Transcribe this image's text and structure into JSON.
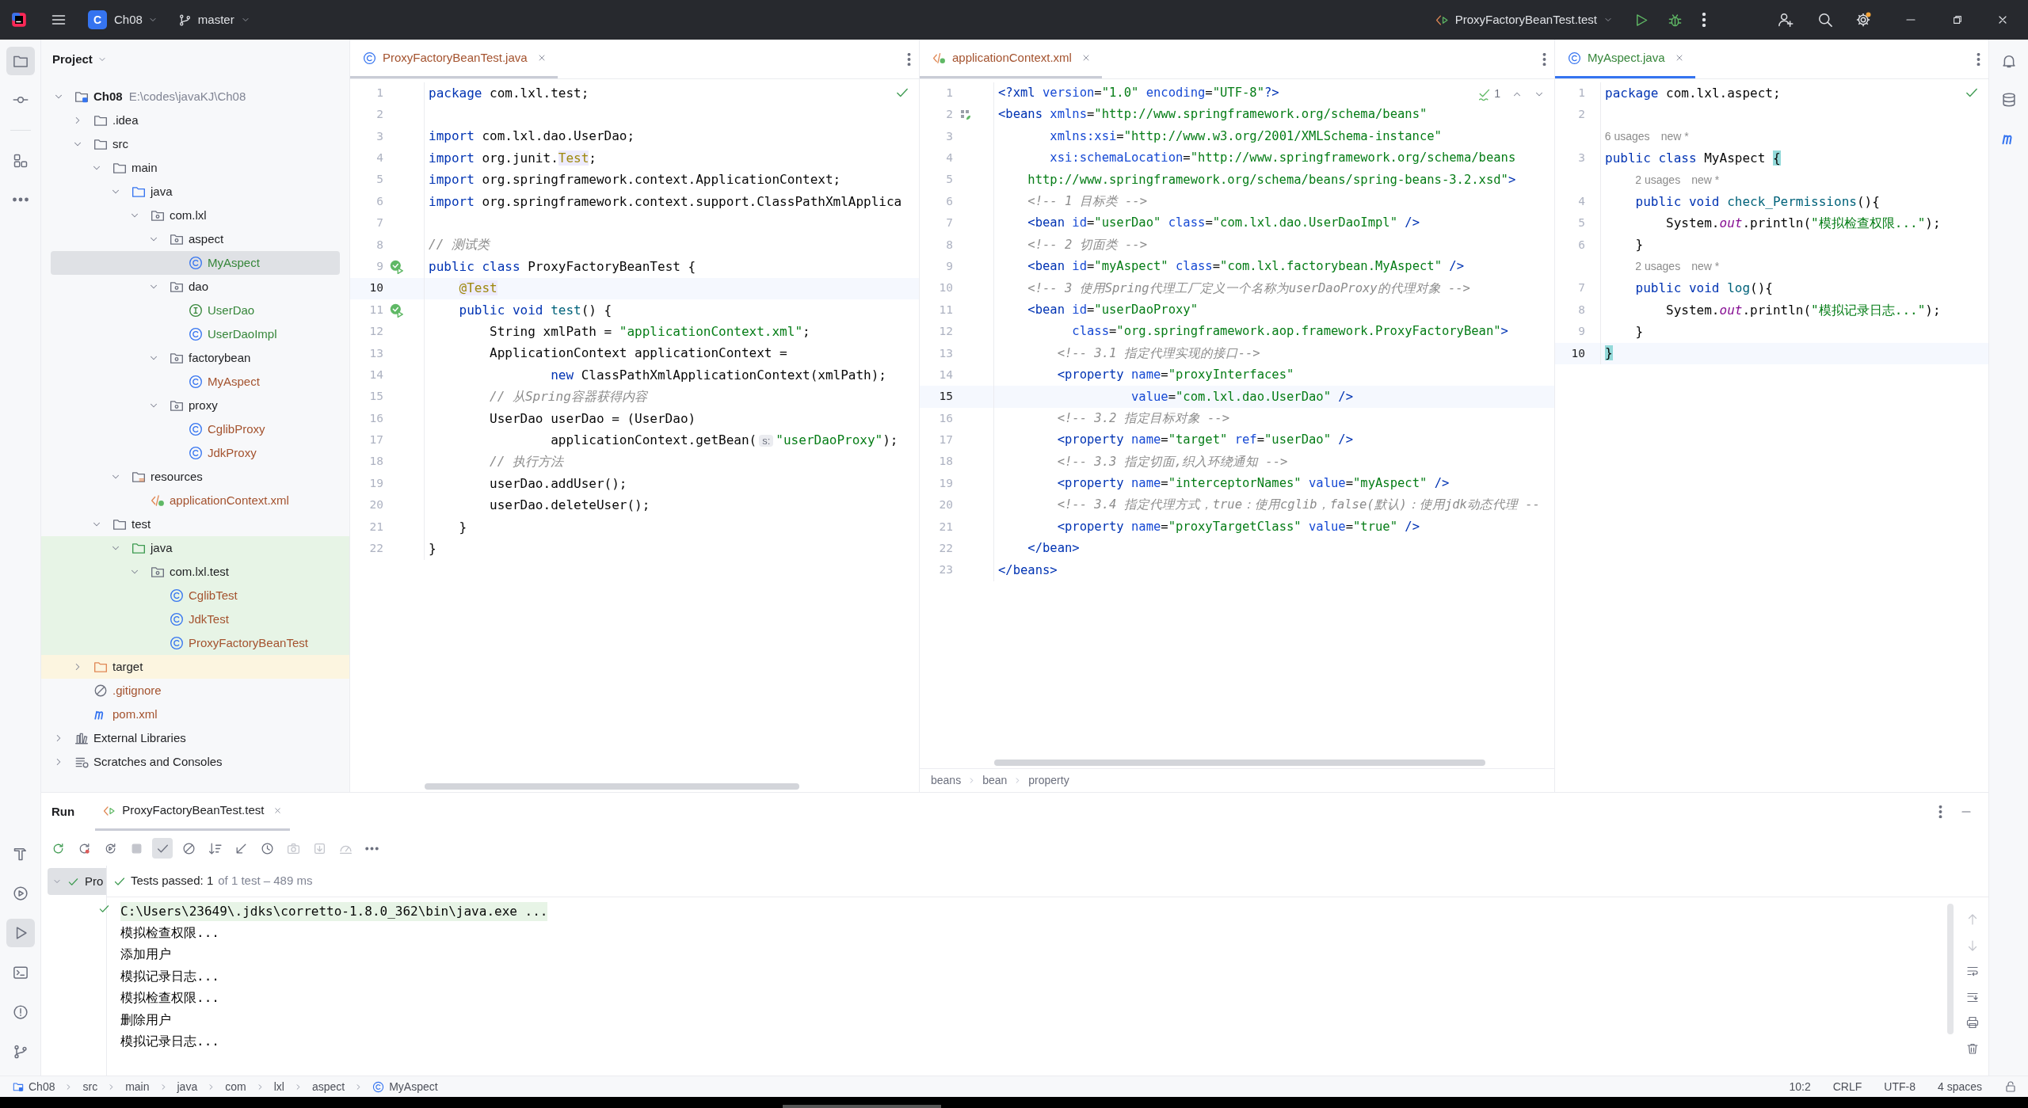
{
  "title_bar": {
    "project_badge": "C",
    "project": "Ch08",
    "branch": "master",
    "run_configuration": "ProxyFactoryBeanTest.test",
    "settings_update": true
  },
  "left_toolbar": {
    "top": [
      {
        "kind": "project",
        "selected": true
      },
      {
        "kind": "commit",
        "selected": false
      },
      {
        "kind": "structure",
        "selected": false
      },
      {
        "kind": "more",
        "selected": false
      }
    ],
    "bottom": [
      {
        "kind": "build",
        "selected": false
      },
      {
        "kind": "services",
        "selected": false
      },
      {
        "kind": "run",
        "selected": true
      },
      {
        "kind": "terminal",
        "selected": false
      },
      {
        "kind": "problems",
        "selected": false
      },
      {
        "kind": "git",
        "selected": false
      }
    ]
  },
  "right_toolbar": [
    {
      "kind": "notifications"
    },
    {
      "kind": "database"
    },
    {
      "kind": "maven"
    }
  ],
  "project_panel": {
    "title": "Project",
    "tree": [
      {
        "label": "Ch08",
        "kind": "module",
        "path": "E:\\codes\\javaKJ\\Ch08",
        "color": "#1e1f22",
        "selected": false,
        "expanded": true,
        "children": [
          {
            "label": ".idea",
            "kind": "folder",
            "color": "#1e1f22",
            "selected": false,
            "expanded": false
          },
          {
            "label": "src",
            "kind": "folder",
            "color": "#1e1f22",
            "selected": false,
            "expanded": true,
            "children": [
              {
                "label": "main",
                "kind": "folder",
                "color": "#1e1f22",
                "selected": false,
                "expanded": true,
                "children": [
                  {
                    "label": "java",
                    "kind": "source",
                    "color": "#1e1f22",
                    "selected": false,
                    "expanded": true,
                    "children": [
                      {
                        "label": "com.lxl",
                        "kind": "package",
                        "color": "#1e1f22",
                        "selected": false,
                        "expanded": true,
                        "children": [
                          {
                            "label": "aspect",
                            "kind": "package",
                            "color": "#1e1f22",
                            "selected": false,
                            "expanded": true,
                            "children": [
                              {
                                "label": "MyAspect",
                                "kind": "class",
                                "color": "#36863a",
                                "selected": true
                              }
                            ]
                          },
                          {
                            "label": "dao",
                            "kind": "package",
                            "color": "#1e1f22",
                            "selected": false,
                            "expanded": true,
                            "children": [
                              {
                                "label": "UserDao",
                                "kind": "interface",
                                "color": "#36863a",
                                "selected": false
                              },
                              {
                                "label": "UserDaoImpl",
                                "kind": "class",
                                "color": "#36863a",
                                "selected": false
                              }
                            ]
                          },
                          {
                            "label": "factorybean",
                            "kind": "package",
                            "color": "#1e1f22",
                            "selected": false,
                            "expanded": true,
                            "children": [
                              {
                                "label": "MyAspect",
                                "kind": "class",
                                "color": "#a4532f",
                                "selected": false
                              }
                            ]
                          },
                          {
                            "label": "proxy",
                            "kind": "package",
                            "color": "#1e1f22",
                            "selected": false,
                            "expanded": true,
                            "children": [
                              {
                                "label": "CglibProxy",
                                "kind": "class",
                                "color": "#a4532f",
                                "selected": false
                              },
                              {
                                "label": "JdkProxy",
                                "kind": "class",
                                "color": "#a4532f",
                                "selected": false
                              }
                            ]
                          }
                        ]
                      }
                    ]
                  },
                  {
                    "label": "resources",
                    "kind": "resources",
                    "color": "#1e1f22",
                    "selected": false,
                    "expanded": true,
                    "children": [
                      {
                        "label": "applicationContext.xml",
                        "kind": "xml",
                        "color": "#a4532f",
                        "selected": false
                      }
                    ]
                  }
                ]
              },
              {
                "label": "test",
                "kind": "folder",
                "color": "#1e1f22",
                "selected": false,
                "expanded": true,
                "children": [
                  {
                    "label": "java",
                    "kind": "test-source",
                    "test_sources": true,
                    "color": "#1e1f22",
                    "selected": false,
                    "expanded": true,
                    "children": [
                      {
                        "label": "com.lxl.test",
                        "kind": "package",
                        "test_sources": true,
                        "color": "#1e1f22",
                        "selected": false,
                        "expanded": true,
                        "children": [
                          {
                            "label": "CglibTest",
                            "kind": "class",
                            "test_sources": true,
                            "color": "#a4532f",
                            "selected": false
                          },
                          {
                            "label": "JdkTest",
                            "kind": "class",
                            "test_sources": true,
                            "color": "#a4532f",
                            "selected": false
                          },
                          {
                            "label": "ProxyFactoryBeanTest",
                            "kind": "class",
                            "test_sources": true,
                            "color": "#a4532f",
                            "selected": false
                          }
                        ]
                      }
                    ]
                  }
                ]
              }
            ]
          },
          {
            "label": "target",
            "kind": "excluded",
            "excluded": true,
            "color": "#1e1f22",
            "selected": false,
            "expanded": false
          },
          {
            "label": ".gitignore",
            "kind": "ignore",
            "color": "#a4532f",
            "selected": false
          },
          {
            "label": "pom.xml",
            "kind": "maven",
            "color": "#a4532f",
            "selected": false
          }
        ]
      },
      {
        "label": "External Libraries",
        "kind": "library",
        "color": "#1e1f22",
        "selected": false,
        "expanded": false
      },
      {
        "label": "Scratches and Consoles",
        "kind": "scratches",
        "color": "#1e1f22",
        "selected": false,
        "expanded": false
      }
    ]
  },
  "editors": [
    {
      "focused": false,
      "h_scrollbar": true,
      "tab": {
        "label": "ProxyFactoryBeanTest.java",
        "kind": "class",
        "color": "#a4532f",
        "selected": true
      },
      "inspection": {
        "kind": "ok"
      },
      "lines": [
        {
          "kind": "code",
          "n": "1",
          "current": false,
          "segs": [
            {
              "kind": "kw",
              "text": "package"
            },
            {
              "kind": "p",
              "text": " com.lxl.test;"
            }
          ]
        },
        {
          "kind": "code",
          "n": "2",
          "current": false
        },
        {
          "kind": "code",
          "n": "3",
          "current": false,
          "segs": [
            {
              "kind": "kw",
              "text": "import"
            },
            {
              "kind": "p",
              "text": " com.lxl.dao.UserDao;"
            }
          ]
        },
        {
          "kind": "code",
          "n": "4",
          "current": false,
          "segs": [
            {
              "kind": "kw",
              "text": "import"
            },
            {
              "kind": "p",
              "text": " org.junit."
            },
            {
              "kind": "annhl",
              "text": "Test"
            },
            {
              "kind": "p",
              "text": ";"
            }
          ]
        },
        {
          "kind": "code",
          "n": "5",
          "current": false,
          "segs": [
            {
              "kind": "kw",
              "text": "import"
            },
            {
              "kind": "p",
              "text": " org.springframework.context.ApplicationContext;"
            }
          ]
        },
        {
          "kind": "code",
          "n": "6",
          "current": false,
          "segs": [
            {
              "kind": "kw",
              "text": "import"
            },
            {
              "kind": "p",
              "text": " org.springframework.context.support.ClassPathXmlApplica"
            }
          ]
        },
        {
          "kind": "code",
          "n": "7",
          "current": false
        },
        {
          "kind": "code",
          "n": "8",
          "current": false,
          "segs": [
            {
              "kind": "cm",
              "text": "// 测试类"
            }
          ]
        },
        {
          "kind": "code",
          "n": "9",
          "current": false,
          "gutter": {
            "kind": "run"
          },
          "segs": [
            {
              "kind": "kw",
              "text": "public class"
            },
            {
              "kind": "p",
              "text": " ProxyFactoryBeanTest {"
            }
          ]
        },
        {
          "kind": "code",
          "n": "10",
          "current": true,
          "segs": [
            {
              "kind": "annhl",
              "text": "    @Test"
            }
          ]
        },
        {
          "kind": "code",
          "n": "11",
          "current": false,
          "gutter": {
            "kind": "run"
          },
          "segs": [
            {
              "kind": "kw",
              "text": "    public void"
            },
            {
              "kind": "fn",
              "text": " test"
            },
            {
              "kind": "p",
              "text": "() {"
            }
          ]
        },
        {
          "kind": "code",
          "n": "12",
          "current": false,
          "segs": [
            {
              "kind": "p",
              "text": "        String xmlPath = "
            },
            {
              "kind": "str",
              "text": "\"applicationContext.xml\""
            },
            {
              "kind": "p",
              "text": ";"
            }
          ]
        },
        {
          "kind": "code",
          "n": "13",
          "current": false,
          "segs": [
            {
              "kind": "p",
              "text": "        ApplicationContext applicationContext ="
            }
          ]
        },
        {
          "kind": "code",
          "n": "14",
          "current": false,
          "segs": [
            {
              "kind": "kw",
              "text": "                new"
            },
            {
              "kind": "p",
              "text": " ClassPathXmlApplicationContext(xmlPath);"
            }
          ]
        },
        {
          "kind": "code",
          "n": "15",
          "current": false,
          "segs": [
            {
              "kind": "cm",
              "text": "        // 从Spring容器获得内容"
            }
          ]
        },
        {
          "kind": "code",
          "n": "16",
          "current": false,
          "segs": [
            {
              "kind": "p",
              "text": "        UserDao userDao = (UserDao)"
            }
          ]
        },
        {
          "kind": "code",
          "n": "17",
          "current": false,
          "segs": [
            {
              "kind": "p",
              "text": "                applicationContext.getBean("
            },
            {
              "kind": "hint",
              "text": "s:"
            },
            {
              "kind": "str",
              "text": "\"userDaoProxy\""
            },
            {
              "kind": "p",
              "text": ");"
            }
          ]
        },
        {
          "kind": "code",
          "n": "18",
          "current": false,
          "segs": [
            {
              "kind": "cm",
              "text": "        // 执行方法"
            }
          ]
        },
        {
          "kind": "code",
          "n": "19",
          "current": false,
          "segs": [
            {
              "kind": "p",
              "text": "        userDao.addUser();"
            }
          ]
        },
        {
          "kind": "code",
          "n": "20",
          "current": false,
          "segs": [
            {
              "kind": "p",
              "text": "        userDao.deleteUser();"
            }
          ]
        },
        {
          "kind": "code",
          "n": "21",
          "current": false,
          "segs": [
            {
              "kind": "p",
              "text": "    }"
            }
          ]
        },
        {
          "kind": "code",
          "n": "22",
          "current": false,
          "segs": [
            {
              "kind": "p",
              "text": "}"
            }
          ]
        }
      ]
    },
    {
      "focused": false,
      "h_scrollbar": true,
      "tab": {
        "label": "applicationContext.xml",
        "kind": "xml",
        "color": "#a4532f",
        "selected": true
      },
      "inspection": {
        "kind": "weak",
        "count": "1"
      },
      "breadcrumbs": [
        "beans",
        "bean",
        "property"
      ],
      "lines": [
        {
          "kind": "code",
          "n": "1",
          "current": false,
          "segs": [
            {
              "kind": "tag",
              "text": "<?xml"
            },
            {
              "kind": "attr",
              "text": " version"
            },
            {
              "kind": "p",
              "text": "="
            },
            {
              "kind": "val",
              "text": "\"1.0\""
            },
            {
              "kind": "attr",
              "text": " encoding"
            },
            {
              "kind": "p",
              "text": "="
            },
            {
              "kind": "val",
              "text": "\"UTF-8\""
            },
            {
              "kind": "tag",
              "text": "?>"
            }
          ]
        },
        {
          "kind": "code",
          "n": "2",
          "current": false,
          "gutter": {
            "kind": "bean"
          },
          "segs": [
            {
              "kind": "tag",
              "text": "<beans"
            },
            {
              "kind": "attr",
              "text": " xmlns"
            },
            {
              "kind": "p",
              "text": "="
            },
            {
              "kind": "val",
              "text": "\"http://www.springframework.org/schema/beans\""
            }
          ]
        },
        {
          "kind": "code",
          "n": "3",
          "current": false,
          "segs": [
            {
              "kind": "attr",
              "text": "       xmlns:xsi"
            },
            {
              "kind": "p",
              "text": "="
            },
            {
              "kind": "val",
              "text": "\"http://www.w3.org/2001/XMLSchema-instance\""
            }
          ]
        },
        {
          "kind": "code",
          "n": "4",
          "current": false,
          "segs": [
            {
              "kind": "attr",
              "text": "       xsi:schemaLocation"
            },
            {
              "kind": "p",
              "text": "="
            },
            {
              "kind": "val",
              "text": "\"http://www.springframework.org/schema/beans"
            }
          ]
        },
        {
          "kind": "code",
          "n": "5",
          "current": false,
          "segs": [
            {
              "kind": "val",
              "text": "    http://www.springframework.org/schema/beans/spring-beans-3.2.xsd\""
            },
            {
              "kind": "tag",
              "text": ">"
            }
          ]
        },
        {
          "kind": "code",
          "n": "6",
          "current": false,
          "segs": [
            {
              "kind": "cm",
              "text": "    <!-- 1 目标类 -->"
            }
          ]
        },
        {
          "kind": "code",
          "n": "7",
          "current": false,
          "segs": [
            {
              "kind": "tag",
              "text": "    <bean"
            },
            {
              "kind": "attr",
              "text": " id"
            },
            {
              "kind": "p",
              "text": "="
            },
            {
              "kind": "val",
              "text": "\"userDao\""
            },
            {
              "kind": "attr",
              "text": " class"
            },
            {
              "kind": "p",
              "text": "="
            },
            {
              "kind": "val",
              "text": "\"com.lxl.dao.UserDaoImpl\""
            },
            {
              "kind": "tag",
              "text": " />"
            }
          ]
        },
        {
          "kind": "code",
          "n": "8",
          "current": false,
          "segs": [
            {
              "kind": "cm",
              "text": "    <!-- 2 切面类 -->"
            }
          ]
        },
        {
          "kind": "code",
          "n": "9",
          "current": false,
          "segs": [
            {
              "kind": "tag",
              "text": "    <bean"
            },
            {
              "kind": "attr",
              "text": " id"
            },
            {
              "kind": "p",
              "text": "="
            },
            {
              "kind": "val",
              "text": "\"myAspect\""
            },
            {
              "kind": "attr",
              "text": " class"
            },
            {
              "kind": "p",
              "text": "="
            },
            {
              "kind": "val",
              "text": "\"com.lxl.factorybean.MyAspect\""
            },
            {
              "kind": "tag",
              "text": " />"
            }
          ]
        },
        {
          "kind": "code",
          "n": "10",
          "current": false,
          "segs": [
            {
              "kind": "cm",
              "text": "    <!-- 3 使用Spring代理工厂定义一个名称为userDaoProxy的代理对象 -->"
            }
          ]
        },
        {
          "kind": "code",
          "n": "11",
          "current": false,
          "segs": [
            {
              "kind": "tag",
              "text": "    <bean"
            },
            {
              "kind": "attr",
              "text": " id"
            },
            {
              "kind": "p",
              "text": "="
            },
            {
              "kind": "val",
              "text": "\"userDaoProxy\""
            }
          ]
        },
        {
          "kind": "code",
          "n": "12",
          "current": false,
          "segs": [
            {
              "kind": "attr",
              "text": "          class"
            },
            {
              "kind": "p",
              "text": "="
            },
            {
              "kind": "val",
              "text": "\"org.springframework.aop.framework.ProxyFactoryBean\""
            },
            {
              "kind": "tag",
              "text": ">"
            }
          ]
        },
        {
          "kind": "code",
          "n": "13",
          "current": false,
          "segs": [
            {
              "kind": "cm",
              "text": "        <!-- 3.1 指定代理实现的接口-->"
            }
          ]
        },
        {
          "kind": "code",
          "n": "14",
          "current": false,
          "segs": [
            {
              "kind": "tag",
              "text": "        <property"
            },
            {
              "kind": "attr",
              "text": " name"
            },
            {
              "kind": "p",
              "text": "="
            },
            {
              "kind": "val",
              "text": "\"proxyInterfaces\""
            }
          ]
        },
        {
          "kind": "code",
          "n": "15",
          "current": true,
          "segs": [
            {
              "kind": "attr",
              "text": "                  value"
            },
            {
              "kind": "p",
              "text": "="
            },
            {
              "kind": "val",
              "text": "\"com.lxl.dao.UserDao\""
            },
            {
              "kind": "tag",
              "text": " />"
            }
          ]
        },
        {
          "kind": "code",
          "n": "16",
          "current": false,
          "segs": [
            {
              "kind": "cm",
              "text": "        <!-- 3.2 指定目标对象 -->"
            }
          ]
        },
        {
          "kind": "code",
          "n": "17",
          "current": false,
          "segs": [
            {
              "kind": "tag",
              "text": "        <property"
            },
            {
              "kind": "attr",
              "text": " name"
            },
            {
              "kind": "p",
              "text": "="
            },
            {
              "kind": "val",
              "text": "\"target\""
            },
            {
              "kind": "attr",
              "text": " ref"
            },
            {
              "kind": "p",
              "text": "="
            },
            {
              "kind": "val",
              "text": "\"userDao\""
            },
            {
              "kind": "tag",
              "text": " />"
            }
          ]
        },
        {
          "kind": "code",
          "n": "18",
          "current": false,
          "segs": [
            {
              "kind": "cm",
              "text": "        <!-- 3.3 指定切面,织入环绕通知 -->"
            }
          ]
        },
        {
          "kind": "code",
          "n": "19",
          "current": false,
          "segs": [
            {
              "kind": "tag",
              "text": "        <property"
            },
            {
              "kind": "attr",
              "text": " name"
            },
            {
              "kind": "p",
              "text": "="
            },
            {
              "kind": "val",
              "text": "\"interceptorNames\""
            },
            {
              "kind": "attr",
              "text": " value"
            },
            {
              "kind": "p",
              "text": "="
            },
            {
              "kind": "val",
              "text": "\"myAspect\""
            },
            {
              "kind": "tag",
              "text": " />"
            }
          ]
        },
        {
          "kind": "code",
          "n": "20",
          "current": false,
          "segs": [
            {
              "kind": "cm",
              "text": "        <!-- 3.4 指定代理方式，true：使用cglib，false(默认)：使用jdk动态代理 --"
            }
          ]
        },
        {
          "kind": "code",
          "n": "21",
          "current": false,
          "segs": [
            {
              "kind": "tag",
              "text": "        <property"
            },
            {
              "kind": "attr",
              "text": " name"
            },
            {
              "kind": "p",
              "text": "="
            },
            {
              "kind": "val",
              "text": "\"proxyTargetClass\""
            },
            {
              "kind": "attr",
              "text": " value"
            },
            {
              "kind": "p",
              "text": "="
            },
            {
              "kind": "val",
              "text": "\"true\""
            },
            {
              "kind": "tag",
              "text": " />"
            }
          ]
        },
        {
          "kind": "code",
          "n": "22",
          "current": false,
          "segs": [
            {
              "kind": "tag",
              "text": "    </bean>"
            }
          ]
        },
        {
          "kind": "code",
          "n": "23",
          "current": false,
          "segs": [
            {
              "kind": "tag",
              "text": "</beans>"
            }
          ]
        }
      ]
    },
    {
      "focused": true,
      "h_scrollbar": false,
      "tab": {
        "label": "MyAspect.java",
        "kind": "class",
        "color": "#36863a",
        "selected": true
      },
      "inspection": {
        "kind": "ok"
      },
      "lines": [
        {
          "kind": "code",
          "n": "1",
          "current": false,
          "segs": [
            {
              "kind": "kw",
              "text": "package"
            },
            {
              "kind": "p",
              "text": " com.lxl.aspect;"
            }
          ]
        },
        {
          "kind": "code",
          "n": "2",
          "current": false
        },
        {
          "kind": "hint",
          "usages": "6 usages",
          "author": "new *"
        },
        {
          "kind": "code",
          "n": "3",
          "current": false,
          "segs": [
            {
              "kind": "kw",
              "text": "public class"
            },
            {
              "kind": "p",
              "text": " MyAspect "
            },
            {
              "kind": "brace",
              "text": "{"
            }
          ]
        },
        {
          "kind": "hint",
          "usages": "2 usages",
          "author": "new *"
        },
        {
          "kind": "code",
          "n": "4",
          "current": false,
          "segs": [
            {
              "kind": "kw",
              "text": "    public void"
            },
            {
              "kind": "fn",
              "text": " check_Permissions"
            },
            {
              "kind": "p",
              "text": "(){"
            }
          ]
        },
        {
          "kind": "code",
          "n": "5",
          "current": false,
          "segs": [
            {
              "kind": "p",
              "text": "        System."
            },
            {
              "kind": "fld",
              "text": "out"
            },
            {
              "kind": "p",
              "text": ".println("
            },
            {
              "kind": "str",
              "text": "\"模拟检查权限...\""
            },
            {
              "kind": "p",
              "text": ");"
            }
          ]
        },
        {
          "kind": "code",
          "n": "6",
          "current": false,
          "segs": [
            {
              "kind": "p",
              "text": "    }"
            }
          ]
        },
        {
          "kind": "hint",
          "usages": "2 usages",
          "author": "new *"
        },
        {
          "kind": "code",
          "n": "7",
          "current": false,
          "segs": [
            {
              "kind": "kw",
              "text": "    public void"
            },
            {
              "kind": "fn",
              "text": " log"
            },
            {
              "kind": "p",
              "text": "(){"
            }
          ]
        },
        {
          "kind": "code",
          "n": "8",
          "current": false,
          "segs": [
            {
              "kind": "p",
              "text": "        System."
            },
            {
              "kind": "fld",
              "text": "out"
            },
            {
              "kind": "p",
              "text": ".println("
            },
            {
              "kind": "str",
              "text": "\"模拟记录日志...\""
            },
            {
              "kind": "p",
              "text": ");"
            }
          ]
        },
        {
          "kind": "code",
          "n": "9",
          "current": false,
          "segs": [
            {
              "kind": "p",
              "text": "    }"
            }
          ]
        },
        {
          "kind": "code",
          "n": "10",
          "current": true,
          "segs": [
            {
              "kind": "brace",
              "text": "}"
            }
          ]
        }
      ]
    }
  ],
  "run_panel": {
    "title": "Run",
    "tab": {
      "label": "ProxyFactoryBeanTest.test",
      "selected": true
    },
    "toolbar": [
      {
        "kind": "rerun",
        "selected": false,
        "disabled": false
      },
      {
        "kind": "rerun-failed",
        "selected": false,
        "disabled": false
      },
      {
        "kind": "rerun-auto",
        "selected": false,
        "disabled": false
      },
      {
        "kind": "stop",
        "selected": false,
        "disabled": true
      },
      {
        "kind": "show-passed",
        "selected": true,
        "disabled": false
      },
      {
        "kind": "show-ignored",
        "selected": false,
        "disabled": false
      },
      {
        "kind": "sort",
        "selected": false,
        "disabled": false
      },
      {
        "kind": "collapse",
        "selected": false,
        "disabled": false
      },
      {
        "kind": "history",
        "selected": false,
        "disabled": false
      },
      {
        "kind": "screenshot",
        "selected": false,
        "disabled": true
      },
      {
        "kind": "import",
        "selected": false,
        "disabled": true
      },
      {
        "kind": "coverage",
        "selected": false,
        "disabled": true
      },
      {
        "kind": "more",
        "selected": false,
        "disabled": false
      }
    ],
    "tests": [
      {
        "label": "Pro",
        "passed": true,
        "selected": true,
        "expanded": true,
        "children": [
          {
            "passed": true,
            "selected": false
          }
        ]
      }
    ],
    "summary": {
      "passed": true,
      "text": "Tests passed: 1",
      "detail": "of 1 test – 489 ms"
    },
    "console": [
      {
        "kind": "command",
        "text": "C:\\Users\\23649\\.jdks\\corretto-1.8.0_362\\bin\\java.exe ..."
      },
      {
        "kind": "output",
        "text": "模拟检查权限..."
      },
      {
        "kind": "output",
        "text": "添加用户"
      },
      {
        "kind": "output",
        "text": "模拟记录日志..."
      },
      {
        "kind": "output",
        "text": "模拟检查权限..."
      },
      {
        "kind": "output",
        "text": "删除用户"
      },
      {
        "kind": "output",
        "text": "模拟记录日志..."
      }
    ],
    "console_tools": [
      {
        "kind": "up",
        "disabled": true
      },
      {
        "kind": "down",
        "disabled": true
      },
      {
        "kind": "soft-wrap",
        "disabled": false
      },
      {
        "kind": "scroll-end",
        "disabled": false
      },
      {
        "kind": "print",
        "disabled": false
      },
      {
        "kind": "clear",
        "disabled": false
      }
    ]
  },
  "status_bar": {
    "breadcrumbs": [
      {
        "label": "Ch08",
        "kind": "module"
      },
      {
        "label": "src"
      },
      {
        "label": "main"
      },
      {
        "label": "java"
      },
      {
        "label": "com"
      },
      {
        "label": "lxl"
      },
      {
        "label": "aspect"
      },
      {
        "label": "MyAspect",
        "kind": "class"
      }
    ],
    "caret": "10:2",
    "line_endings": "CRLF",
    "encoding": "UTF-8",
    "indent": "4 spaces"
  }
}
